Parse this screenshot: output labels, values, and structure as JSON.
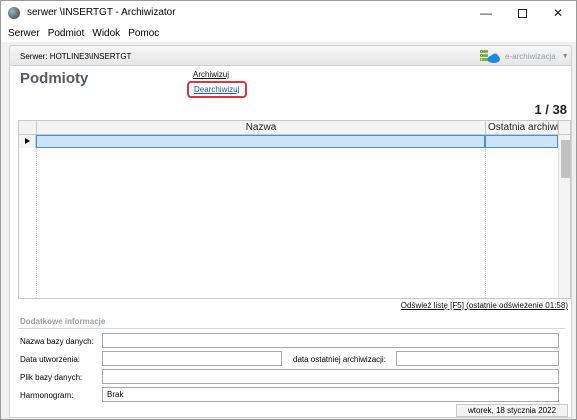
{
  "window": {
    "title": "serwer \\INSERTGT - Archiwizator",
    "minimize_glyph": "—",
    "close_glyph": "✕"
  },
  "menu": [
    "Serwer",
    "Podmiot",
    "Widok",
    "Pomoc"
  ],
  "server_bar": {
    "label": "Serwer:  HOTLINE3\\INSERTGT",
    "earchiwizacja_label": "e-archiwizacja",
    "earchiwizacja_arrow": "▼"
  },
  "page": {
    "title": "Podmioty",
    "action_archive": "Archiwizuj",
    "action_dearchive": "Dearchiwizuj",
    "record_counter": "1 / 38"
  },
  "grid": {
    "columns": [
      "Nazwa",
      "Ostatnia archiwi"
    ],
    "selected_row": [
      "",
      ""
    ],
    "refresh_link": "Odśwież listę [F5] (ostatnie odświeżenie 01:58)"
  },
  "details": {
    "section_title": "Dodatkowe informacje",
    "db_name_label": "Nazwa bazy danych:",
    "db_name_value": "",
    "created_label": "Data utworzenia:",
    "created_value": "",
    "last_archive_label": "data ostatniej archiwizacji:",
    "last_archive_value": "",
    "db_file_label": "Plik bazy danych:",
    "db_file_value": "",
    "schedule_label": "Harmonogram:",
    "schedule_value": "Brak"
  },
  "status": {
    "date": "wtorek, 18 stycznia 2022"
  },
  "colors": {
    "accent_link": "#1a5fb4",
    "highlight_border": "#e0353b",
    "selection_fill": "#cce4f7",
    "selection_border": "#4a90d9"
  },
  "icons": {
    "app": "app-globe-icon",
    "earchiwizacja": "cloud-server-icon",
    "row_indicator": "row-pointer-icon"
  }
}
